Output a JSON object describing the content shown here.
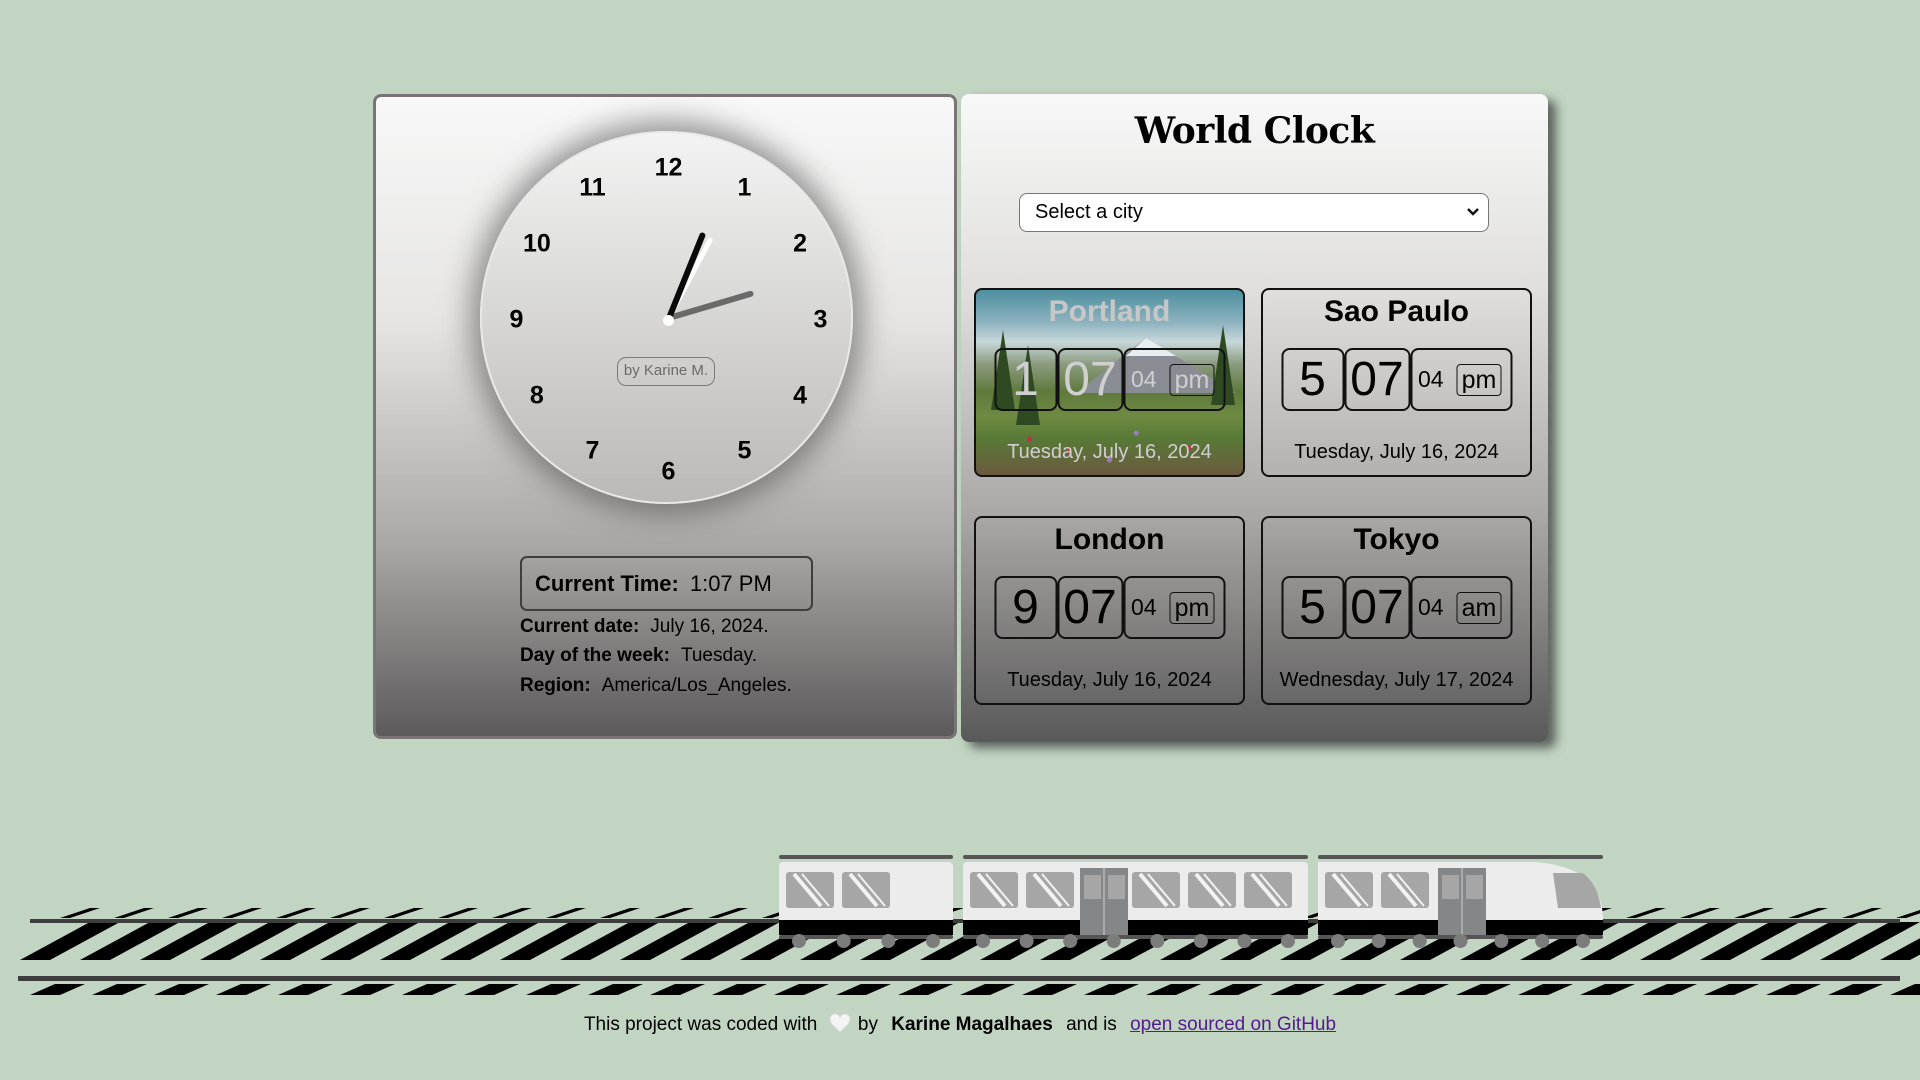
{
  "analog_clock": {
    "numbers": [
      "12",
      "1",
      "2",
      "3",
      "4",
      "5",
      "6",
      "7",
      "8",
      "9",
      "10",
      "11"
    ],
    "signature": "by Karine M.",
    "time": {
      "hours": 1,
      "minutes": 7,
      "seconds": 4
    }
  },
  "current_info": {
    "time_label": "Current Time:",
    "time_value": "1:07 PM",
    "date_label": "Current date:",
    "date_value": "July 16, 2024.",
    "weekday_label": "Day of the week:",
    "weekday_value": "Tuesday.",
    "region_label": "Region:",
    "region_value": "America/Los_Angeles."
  },
  "world_clock": {
    "title": "World Clock",
    "select": {
      "selected": "Select a city",
      "icon": "chevron-down-icon"
    },
    "cities": [
      {
        "name": "Portland",
        "hour": "1",
        "minute": "07",
        "second": "04",
        "ampm": "pm",
        "date": "Tuesday, July 16, 2024",
        "background": "mountain-photo"
      },
      {
        "name": "Sao Paulo",
        "hour": "5",
        "minute": "07",
        "second": "04",
        "ampm": "pm",
        "date": "Tuesday, July 16, 2024"
      },
      {
        "name": "London",
        "hour": "9",
        "minute": "07",
        "second": "04",
        "ampm": "pm",
        "date": "Tuesday, July 16, 2024"
      },
      {
        "name": "Tokyo",
        "hour": "5",
        "minute": "07",
        "second": "04",
        "ampm": "am",
        "date": "Wednesday, July 17, 2024"
      }
    ]
  },
  "footer": {
    "text_before": "This project was coded with",
    "heart_icon": "heart-icon",
    "by": "by",
    "author": "Karine Magalhaes",
    "text_middle": "and is",
    "link_text": "open sourced on GitHub"
  },
  "colors": {
    "background": "#c1d5c2",
    "link": "#551a8b",
    "panel_border": "#7a7476"
  }
}
